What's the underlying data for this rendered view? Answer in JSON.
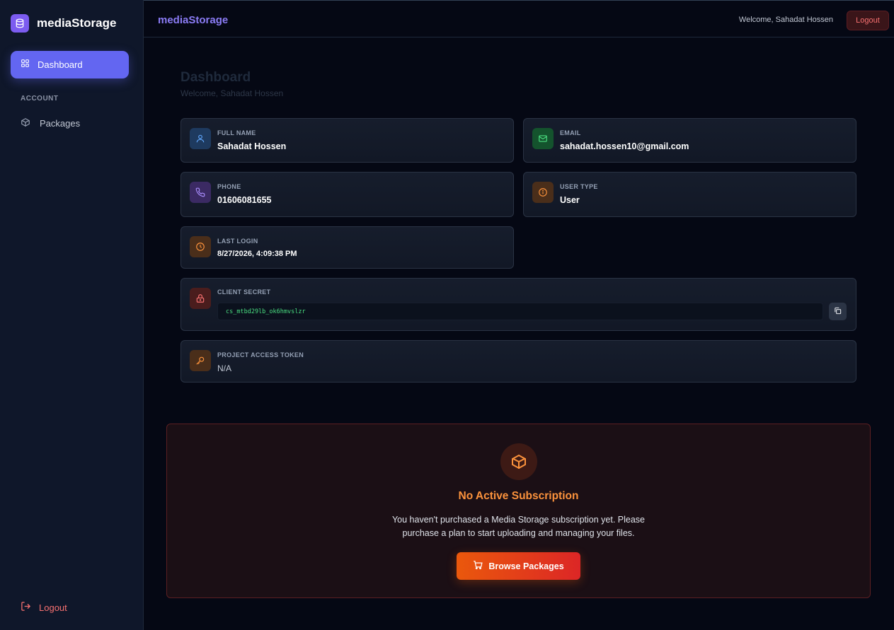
{
  "sidebar": {
    "brand": "mediaStorage",
    "nav_active": "Dashboard",
    "section_label": "ACCOUNT",
    "nav_packages": "Packages",
    "logout": "Logout"
  },
  "topbar": {
    "brand": "mediaStorage",
    "welcome": "Welcome, Sahadat Hossen",
    "logout": "Logout"
  },
  "page": {
    "title": "Dashboard",
    "subtitle": "Welcome, Sahadat Hossen"
  },
  "info": {
    "full_name": {
      "label": "FULL NAME",
      "value": "Sahadat Hossen"
    },
    "email": {
      "label": "EMAIL",
      "value": "sahadat.hossen10@gmail.com"
    },
    "phone": {
      "label": "PHONE",
      "value": "01606081655"
    },
    "user_type": {
      "label": "USER TYPE",
      "value": "User"
    },
    "last_login": {
      "label": "LAST LOGIN",
      "value": "8/27/2026, 4:09:38 PM"
    },
    "client_secret": {
      "label": "CLIENT SECRET",
      "value": "cs_mtbd29lb_ok6hmvslzr"
    },
    "access_token": {
      "label": "PROJECT ACCESS TOKEN",
      "value": "N/A"
    }
  },
  "subscription": {
    "title": "No Active Subscription",
    "line1": "You haven't purchased a Media Storage subscription yet. Please",
    "line2": "purchase a plan to start uploading and managing your files.",
    "button": "Browse Packages"
  },
  "colors": {
    "accent": "#6366f1",
    "brand_text": "#8b7cf6",
    "warning": "#fb923c",
    "danger": "#f87171",
    "secret_text": "#4ade80"
  }
}
